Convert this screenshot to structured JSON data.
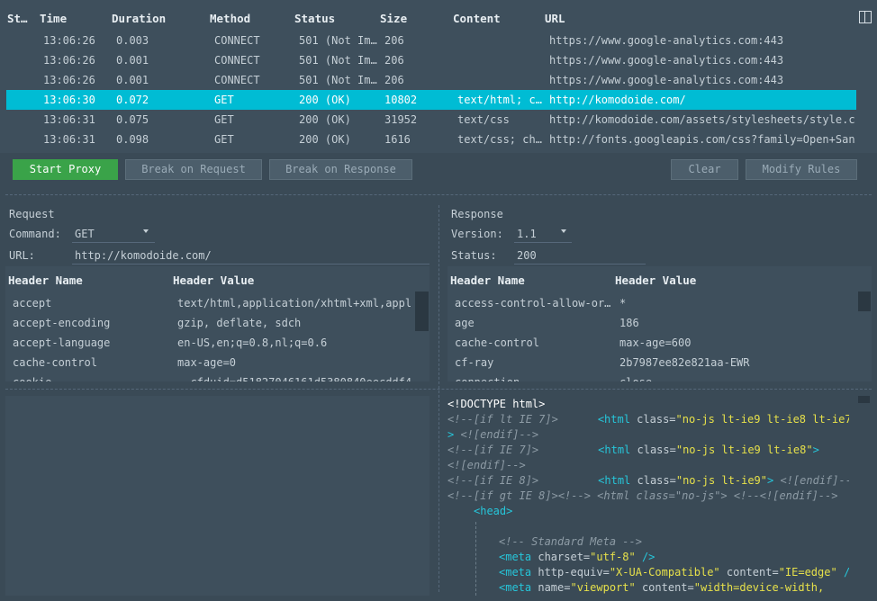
{
  "table": {
    "columns": [
      "St…",
      "Time",
      "Duration",
      "Method",
      "Status",
      "Size",
      "Content",
      "URL"
    ],
    "rows": [
      {
        "time": "13:06:26",
        "duration": "0.003",
        "method": "CONNECT",
        "status": "501 (Not Im…",
        "size": "206",
        "content": "",
        "url": "https://www.google-analytics.com:443"
      },
      {
        "time": "13:06:26",
        "duration": "0.001",
        "method": "CONNECT",
        "status": "501 (Not Im…",
        "size": "206",
        "content": "",
        "url": "https://www.google-analytics.com:443"
      },
      {
        "time": "13:06:26",
        "duration": "0.001",
        "method": "CONNECT",
        "status": "501 (Not Im…",
        "size": "206",
        "content": "",
        "url": "https://www.google-analytics.com:443"
      },
      {
        "time": "13:06:30",
        "duration": "0.072",
        "method": "GET",
        "status": "200 (OK)",
        "size": "10802",
        "content": "text/html; c…",
        "url": "http://komodoide.com/"
      },
      {
        "time": "13:06:31",
        "duration": "0.075",
        "method": "GET",
        "status": "200 (OK)",
        "size": "31952",
        "content": "text/css",
        "url": "http://komodoide.com/assets/stylesheets/style.c…"
      },
      {
        "time": "13:06:31",
        "duration": "0.098",
        "method": "GET",
        "status": "200 (OK)",
        "size": "1616",
        "content": "text/css; ch…",
        "url": "http://fonts.googleapis.com/css?family=Open+San…"
      }
    ],
    "selected_row": 3
  },
  "toolbar": {
    "start_proxy": "Start Proxy",
    "break_request": "Break on Request",
    "break_response": "Break on Response",
    "clear": "Clear",
    "modify_rules": "Modify Rules"
  },
  "request": {
    "title": "Request",
    "command_label": "Command:",
    "command_value": "GET",
    "url_label": "URL:",
    "url_value": "http://komodoide.com/",
    "header_name_col": "Header Name",
    "header_value_col": "Header Value",
    "headers": [
      {
        "name": "accept",
        "value": "text/html,application/xhtml+xml,appl…"
      },
      {
        "name": "accept-encoding",
        "value": "gzip, deflate, sdch"
      },
      {
        "name": "accept-language",
        "value": "en-US,en;q=0.8,nl;q=0.6"
      },
      {
        "name": "cache-control",
        "value": "max-age=0"
      },
      {
        "name": "cookie",
        "value": "__cfduid=d51827046161d5380840eecddf4"
      }
    ]
  },
  "response": {
    "title": "Response",
    "version_label": "Version:",
    "version_value": "1.1",
    "status_label": "Status:",
    "status_value": "200",
    "header_name_col": "Header Name",
    "header_value_col": "Header Value",
    "headers": [
      {
        "name": "access-control-allow-or…",
        "value": "*"
      },
      {
        "name": "age",
        "value": "186"
      },
      {
        "name": "cache-control",
        "value": "max-age=600"
      },
      {
        "name": "cf-ray",
        "value": "2b7987ee82e821aa-EWR"
      },
      {
        "name": "connection",
        "value": "close"
      }
    ]
  },
  "code": {
    "l1": "<!DOCTYPE html>",
    "l2a": "<!--[if lt IE 7]>",
    "l2b": "<html",
    "l2c": " class=",
    "l2d": "\"no-js lt-ie9 lt-ie8 lt-ie7\"",
    "l3a": ">",
    "l3b": " <![endif]-->",
    "l4a": "<!--[if IE 7]>",
    "l4b": "<html",
    "l4c": " class=",
    "l4d": "\"no-js lt-ie9 lt-ie8\"",
    "l4e": ">",
    "l5": "<![endif]-->",
    "l6a": "<!--[if IE 8]>",
    "l6b": "<html",
    "l6c": " class=",
    "l6d": "\"no-js lt-ie9\"",
    "l6e": ">",
    "l6f": " <![endif]-->",
    "l7": "<!--[if gt IE 8]><!--> <html class=\"no-js\"> <!--<![endif]-->",
    "l8": "<head>",
    "l9": "<!-- Standard Meta -->",
    "l10a": "<meta",
    "l10b": " charset=",
    "l10c": "\"utf-8\"",
    "l10d": " />",
    "l11a": "<meta",
    "l11b": " http-equiv=",
    "l11c": "\"X-UA-Compatible\"",
    "l11d": " content=",
    "l11e": "\"IE=edge\"",
    "l11f": " />",
    "l12a": "<meta",
    "l12b": " name=",
    "l12c": "\"viewport\"",
    "l12d": " content=",
    "l12e": "\"width=device-width,"
  }
}
